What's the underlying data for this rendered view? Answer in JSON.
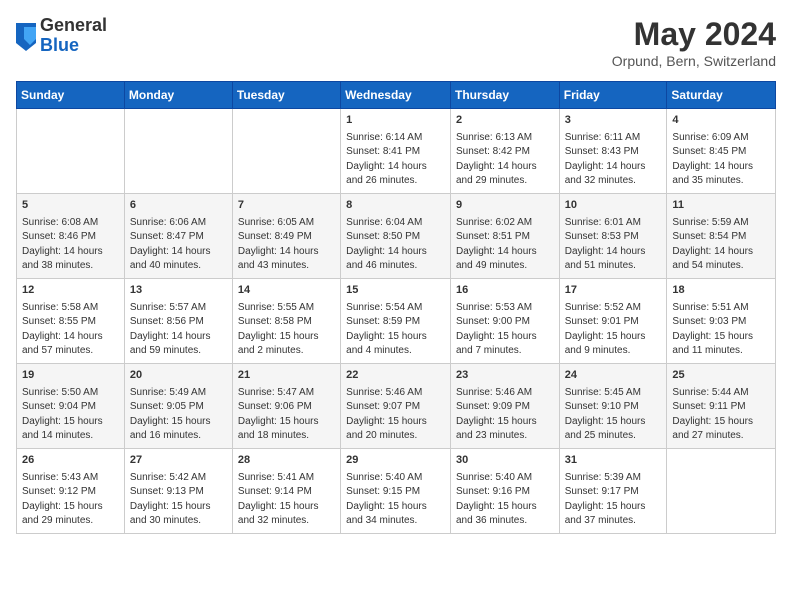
{
  "header": {
    "logo_general": "General",
    "logo_blue": "Blue",
    "month_title": "May 2024",
    "location": "Orpund, Bern, Switzerland"
  },
  "days_of_week": [
    "Sunday",
    "Monday",
    "Tuesday",
    "Wednesday",
    "Thursday",
    "Friday",
    "Saturday"
  ],
  "weeks": [
    [
      {
        "day": "",
        "info": ""
      },
      {
        "day": "",
        "info": ""
      },
      {
        "day": "",
        "info": ""
      },
      {
        "day": "1",
        "info": "Sunrise: 6:14 AM\nSunset: 8:41 PM\nDaylight: 14 hours\nand 26 minutes."
      },
      {
        "day": "2",
        "info": "Sunrise: 6:13 AM\nSunset: 8:42 PM\nDaylight: 14 hours\nand 29 minutes."
      },
      {
        "day": "3",
        "info": "Sunrise: 6:11 AM\nSunset: 8:43 PM\nDaylight: 14 hours\nand 32 minutes."
      },
      {
        "day": "4",
        "info": "Sunrise: 6:09 AM\nSunset: 8:45 PM\nDaylight: 14 hours\nand 35 minutes."
      }
    ],
    [
      {
        "day": "5",
        "info": "Sunrise: 6:08 AM\nSunset: 8:46 PM\nDaylight: 14 hours\nand 38 minutes."
      },
      {
        "day": "6",
        "info": "Sunrise: 6:06 AM\nSunset: 8:47 PM\nDaylight: 14 hours\nand 40 minutes."
      },
      {
        "day": "7",
        "info": "Sunrise: 6:05 AM\nSunset: 8:49 PM\nDaylight: 14 hours\nand 43 minutes."
      },
      {
        "day": "8",
        "info": "Sunrise: 6:04 AM\nSunset: 8:50 PM\nDaylight: 14 hours\nand 46 minutes."
      },
      {
        "day": "9",
        "info": "Sunrise: 6:02 AM\nSunset: 8:51 PM\nDaylight: 14 hours\nand 49 minutes."
      },
      {
        "day": "10",
        "info": "Sunrise: 6:01 AM\nSunset: 8:53 PM\nDaylight: 14 hours\nand 51 minutes."
      },
      {
        "day": "11",
        "info": "Sunrise: 5:59 AM\nSunset: 8:54 PM\nDaylight: 14 hours\nand 54 minutes."
      }
    ],
    [
      {
        "day": "12",
        "info": "Sunrise: 5:58 AM\nSunset: 8:55 PM\nDaylight: 14 hours\nand 57 minutes."
      },
      {
        "day": "13",
        "info": "Sunrise: 5:57 AM\nSunset: 8:56 PM\nDaylight: 14 hours\nand 59 minutes."
      },
      {
        "day": "14",
        "info": "Sunrise: 5:55 AM\nSunset: 8:58 PM\nDaylight: 15 hours\nand 2 minutes."
      },
      {
        "day": "15",
        "info": "Sunrise: 5:54 AM\nSunset: 8:59 PM\nDaylight: 15 hours\nand 4 minutes."
      },
      {
        "day": "16",
        "info": "Sunrise: 5:53 AM\nSunset: 9:00 PM\nDaylight: 15 hours\nand 7 minutes."
      },
      {
        "day": "17",
        "info": "Sunrise: 5:52 AM\nSunset: 9:01 PM\nDaylight: 15 hours\nand 9 minutes."
      },
      {
        "day": "18",
        "info": "Sunrise: 5:51 AM\nSunset: 9:03 PM\nDaylight: 15 hours\nand 11 minutes."
      }
    ],
    [
      {
        "day": "19",
        "info": "Sunrise: 5:50 AM\nSunset: 9:04 PM\nDaylight: 15 hours\nand 14 minutes."
      },
      {
        "day": "20",
        "info": "Sunrise: 5:49 AM\nSunset: 9:05 PM\nDaylight: 15 hours\nand 16 minutes."
      },
      {
        "day": "21",
        "info": "Sunrise: 5:47 AM\nSunset: 9:06 PM\nDaylight: 15 hours\nand 18 minutes."
      },
      {
        "day": "22",
        "info": "Sunrise: 5:46 AM\nSunset: 9:07 PM\nDaylight: 15 hours\nand 20 minutes."
      },
      {
        "day": "23",
        "info": "Sunrise: 5:46 AM\nSunset: 9:09 PM\nDaylight: 15 hours\nand 23 minutes."
      },
      {
        "day": "24",
        "info": "Sunrise: 5:45 AM\nSunset: 9:10 PM\nDaylight: 15 hours\nand 25 minutes."
      },
      {
        "day": "25",
        "info": "Sunrise: 5:44 AM\nSunset: 9:11 PM\nDaylight: 15 hours\nand 27 minutes."
      }
    ],
    [
      {
        "day": "26",
        "info": "Sunrise: 5:43 AM\nSunset: 9:12 PM\nDaylight: 15 hours\nand 29 minutes."
      },
      {
        "day": "27",
        "info": "Sunrise: 5:42 AM\nSunset: 9:13 PM\nDaylight: 15 hours\nand 30 minutes."
      },
      {
        "day": "28",
        "info": "Sunrise: 5:41 AM\nSunset: 9:14 PM\nDaylight: 15 hours\nand 32 minutes."
      },
      {
        "day": "29",
        "info": "Sunrise: 5:40 AM\nSunset: 9:15 PM\nDaylight: 15 hours\nand 34 minutes."
      },
      {
        "day": "30",
        "info": "Sunrise: 5:40 AM\nSunset: 9:16 PM\nDaylight: 15 hours\nand 36 minutes."
      },
      {
        "day": "31",
        "info": "Sunrise: 5:39 AM\nSunset: 9:17 PM\nDaylight: 15 hours\nand 37 minutes."
      },
      {
        "day": "",
        "info": ""
      }
    ]
  ]
}
